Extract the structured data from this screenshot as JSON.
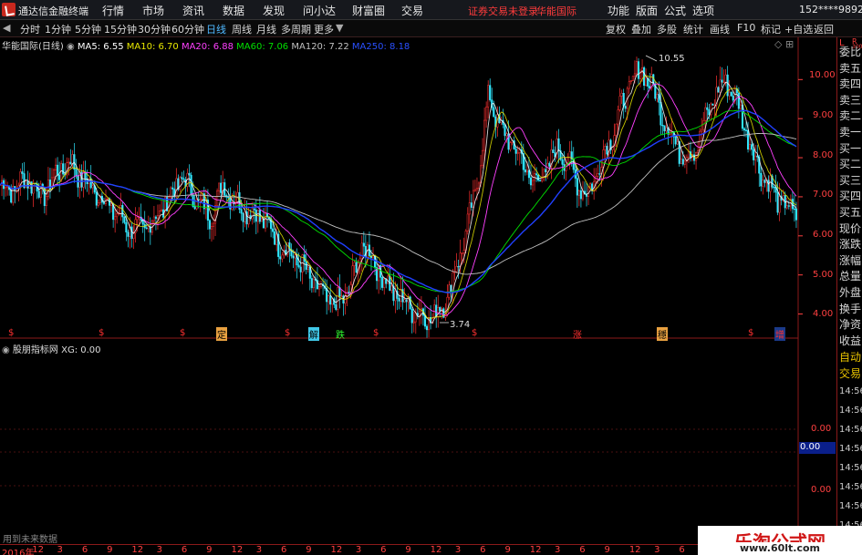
{
  "app": {
    "name": "通达信金融终端"
  },
  "menu": [
    "行情",
    "市场",
    "资讯",
    "数据",
    "发现",
    "问小达",
    "财富圈",
    "交易"
  ],
  "warning": {
    "text1": "证券交易未登录",
    "text2": "华能国际"
  },
  "menu_right": [
    "功能",
    "版面",
    "公式",
    "选项"
  ],
  "account": "152****9892",
  "window_controls": [
    "—",
    "□",
    "✕"
  ],
  "toolbar": {
    "periods": [
      "分时",
      "1分钟",
      "5分钟",
      "15分钟",
      "30分钟",
      "60分钟",
      "日线",
      "周线",
      "月线",
      "多周期",
      "更多"
    ],
    "active": "日线",
    "right": [
      "复权",
      "叠加",
      "多股",
      "统计",
      "画线",
      "F10",
      "标记",
      "+自选",
      "返回"
    ]
  },
  "legend": {
    "name": "华能国际(日线)",
    "ma": [
      {
        "label": "MA5: 6.55",
        "color": "#ffffff"
      },
      {
        "label": "MA10: 6.70",
        "color": "#e8e800"
      },
      {
        "label": "MA20: 6.88",
        "color": "#ff40ff"
      },
      {
        "label": "MA60: 7.06",
        "color": "#00e000"
      },
      {
        "label": "MA120: 7.22",
        "color": "#c0c0c0"
      },
      {
        "label": "MA250: 8.18",
        "color": "#2040ff"
      }
    ]
  },
  "sub_legend": {
    "name": "股朋指标网",
    "value": "XG: 0.00"
  },
  "y_axis": [
    "10.00",
    "9.00",
    "8.00",
    "7.00",
    "6.00",
    "5.00",
    "4.00"
  ],
  "sub_y_axis": [
    "0.00",
    "0.00"
  ],
  "sub_y_current": "0.00",
  "annotations": {
    "high": "10.55",
    "low": "3.74"
  },
  "signals": [
    "$",
    "$",
    "$",
    "定",
    "$",
    "解",
    "跌",
    "$",
    "$",
    "涨",
    "穩",
    "$",
    "增"
  ],
  "sidebar": {
    "top": "L",
    "r": "R",
    "r_sub": "300",
    "items": [
      "委比",
      "卖五",
      "卖四",
      "卖三",
      "卖二",
      "卖一",
      "买一",
      "买二",
      "买三",
      "买四",
      "买五",
      "现价",
      "涨跌",
      "涨幅",
      "总量",
      "外盘",
      "换手",
      "净资",
      "收益"
    ],
    "lower": [
      "自动",
      "交易"
    ],
    "times": [
      "14:56",
      "14:56",
      "14:56",
      "14:56",
      "14:56",
      "14:56",
      "14:56",
      "14:56"
    ]
  },
  "bottom_tip": "用到未来数据",
  "x_axis": [
    "2016年",
    "12",
    "3",
    "6",
    "9",
    "12",
    "3",
    "6",
    "9",
    "12",
    "3",
    "6",
    "9",
    "12",
    "3",
    "6",
    "9",
    "12",
    "3",
    "6",
    "9",
    "12",
    "3",
    "6",
    "9",
    "12",
    "3",
    "6",
    "9",
    "12",
    "3",
    "6",
    "9"
  ],
  "watermark": {
    "title": "乐淘公式网",
    "url": "www.60lt.com"
  },
  "chart_data": {
    "type": "candlestick",
    "ylim": [
      3.5,
      10.8
    ],
    "close_path": [
      7.3,
      7.2,
      7.5,
      7.0,
      7.6,
      7.9,
      7.4,
      7.1,
      6.7,
      6.3,
      6.1,
      6.4,
      6.9,
      7.5,
      7.0,
      6.5,
      7.3,
      6.8,
      6.6,
      6.4,
      5.8,
      5.5,
      5.0,
      4.5,
      4.2,
      4.6,
      5.8,
      5.2,
      4.6,
      4.3,
      4.0,
      3.9,
      4.4,
      5.6,
      7.0,
      9.6,
      8.6,
      8.2,
      7.4,
      7.6,
      8.3,
      7.6,
      7.0,
      7.9,
      8.8,
      9.8,
      10.3,
      9.5,
      8.6,
      8.0,
      8.4,
      9.5,
      10.0,
      9.2,
      8.0,
      7.3,
      6.8,
      6.6
    ]
  }
}
